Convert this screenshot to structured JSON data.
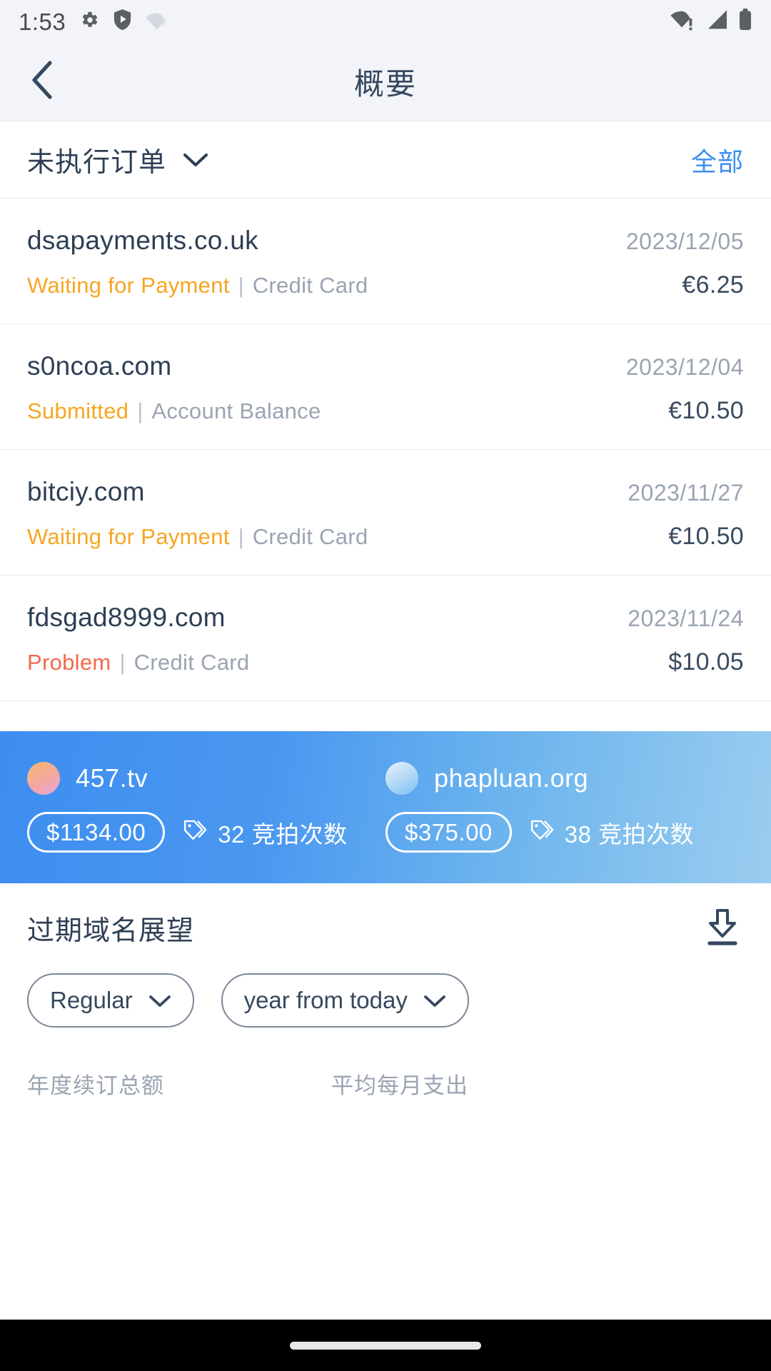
{
  "status_bar": {
    "time": "1:53",
    "left_icons": [
      "gear-icon",
      "shield-play-icon",
      "wifi-question-icon"
    ],
    "right_icons": [
      "wifi-alert-icon",
      "cell-signal-icon",
      "battery-full-icon"
    ]
  },
  "app_bar": {
    "back_icon": "chevron-left-icon",
    "title": "概要"
  },
  "orders_section": {
    "title": "未执行订单",
    "caret_icon": "chevron-down-icon",
    "all_label": "全部",
    "accent_color": "#3d8ef0",
    "separator": "|",
    "items": [
      {
        "domain": "dsapayments.co.uk",
        "date": "2023/12/05",
        "status": "Waiting for Payment",
        "status_kind": "warn",
        "method": "Credit Card",
        "price": "€6.25"
      },
      {
        "domain": "s0ncoa.com",
        "date": "2023/12/04",
        "status": "Submitted",
        "status_kind": "warn",
        "method": "Account Balance",
        "price": "€10.50"
      },
      {
        "domain": "bitciy.com",
        "date": "2023/11/27",
        "status": "Waiting for Payment",
        "status_kind": "warn",
        "method": "Credit Card",
        "price": "€10.50"
      },
      {
        "domain": "fdsgad8999.com",
        "date": "2023/11/24",
        "status": "Problem",
        "status_kind": "error",
        "method": "Credit Card",
        "price": "$10.05"
      }
    ],
    "status_colors": {
      "warn": "#f5a623",
      "error": "#f4694d"
    }
  },
  "auction_banner": {
    "gradient_from": "#3d8ef0",
    "gradient_to": "#9acdef",
    "items": [
      {
        "domain": "457.tv",
        "avatar": "gradient-circle-orange-pink",
        "price": "$1134.00",
        "tag_icon": "tag-icon",
        "bids": "32 竞拍次数"
      },
      {
        "domain": "phapluan.org",
        "avatar": "gradient-circle-blue",
        "price": "$375.00",
        "tag_icon": "tag-icon",
        "bids": "38 竞拍次数"
      }
    ]
  },
  "forecast_section": {
    "title": "过期域名展望",
    "download_icon": "download-icon",
    "selects": [
      {
        "value": "Regular",
        "caret_icon": "chevron-down-icon"
      },
      {
        "value": "year from today",
        "caret_icon": "chevron-down-icon"
      }
    ],
    "labels": [
      "年度续订总额",
      "平均每月支出"
    ]
  },
  "nav_bar": {
    "home_indicator": "home-indicator"
  }
}
